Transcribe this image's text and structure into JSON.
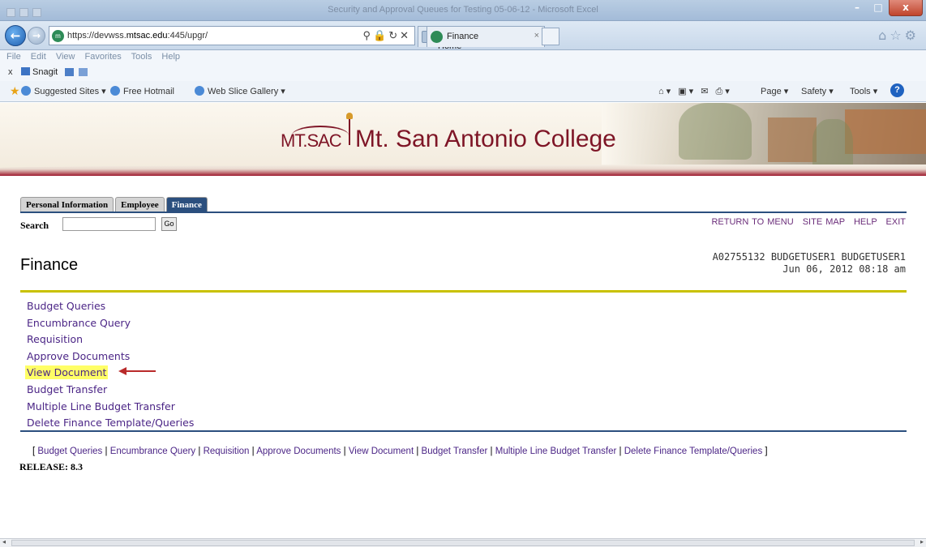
{
  "window": {
    "title": "Security and Approval Queues for Testing 05-06-12 - Microsoft Excel"
  },
  "browser": {
    "address": {
      "prefix": "https://devwss.",
      "domain": "mtsac.edu",
      "suffix": ":445/upgr/"
    },
    "tabs": [
      {
        "label": "Mt. SAC Banner Home"
      },
      {
        "label": "Finance"
      }
    ],
    "menu": [
      "File",
      "Edit",
      "View",
      "Favorites",
      "Tools",
      "Help"
    ],
    "toolbar": {
      "close": "x",
      "snagit": "Snagit"
    },
    "favorites": [
      "Suggested Sites ▾",
      "Free Hotmail",
      "Web Slice Gallery ▾"
    ],
    "commands": {
      "page": "Page ▾",
      "safety": "Safety ▾",
      "tools": "Tools ▾"
    }
  },
  "banner": {
    "logo_mark": "MT.SAC",
    "college_name": "Mt. San Antonio College"
  },
  "nav_tabs": [
    {
      "label": "Personal Information",
      "active": false
    },
    {
      "label": "Employee",
      "active": false
    },
    {
      "label": "Finance",
      "active": true
    }
  ],
  "search": {
    "label": "Search",
    "value": "",
    "go": "Go"
  },
  "top_links": [
    "RETURN TO MENU",
    "SITE MAP",
    "HELP",
    "EXIT"
  ],
  "page": {
    "heading": "Finance"
  },
  "user": {
    "line1": "A02755132 BUDGETUSER1 BUDGETUSER1",
    "line2": "Jun 06, 2012 08:18 am"
  },
  "menu_items": [
    "Budget Queries",
    "Encumbrance Query",
    "Requisition",
    "Approve Documents",
    "View Document",
    "Budget Transfer",
    "Multiple Line Budget Transfer",
    "Delete Finance Template/Queries"
  ],
  "highlighted_item": "View Document",
  "footer": {
    "open": "[ ",
    "close": " ]",
    "separator": " | ",
    "release": "RELEASE: 8.3"
  },
  "colors": {
    "link": "#4b2586",
    "accent_rule": "#c9c100",
    "nav_blue": "#2b4f7e",
    "brand": "#7e1526",
    "highlight": "#ffff66"
  }
}
